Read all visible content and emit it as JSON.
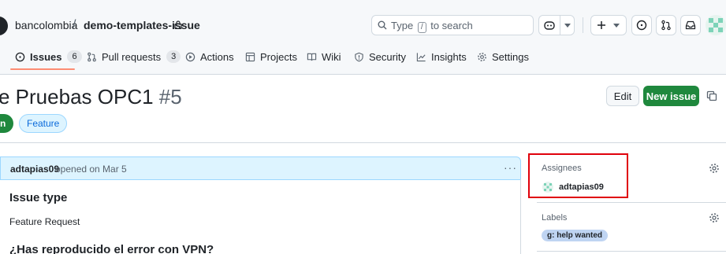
{
  "header": {
    "owner": "bancolombia",
    "separator": "/",
    "repo": "demo-templates-issue",
    "search": {
      "prefix": "Type",
      "key": "/",
      "suffix": "to search"
    }
  },
  "tabs": [
    {
      "label": "Issues",
      "count": "6"
    },
    {
      "label": "Pull requests",
      "count": "3"
    },
    {
      "label": "Actions"
    },
    {
      "label": "Projects"
    },
    {
      "label": "Wiki"
    },
    {
      "label": "Security"
    },
    {
      "label": "Insights"
    },
    {
      "label": "Settings"
    }
  ],
  "issue": {
    "title": "e Pruebas OPC1",
    "number": "#5",
    "status": "n",
    "labels": [
      "Feature"
    ],
    "edit_label": "Edit",
    "new_issue_label": "New issue"
  },
  "comment": {
    "author": "adtapias09",
    "meta": "opened on Mar 5",
    "heading1": "Issue type",
    "text1": "Feature Request",
    "heading2": "¿Has reproducido el error con VPN?"
  },
  "sidebar": {
    "assignees_title": "Assignees",
    "assignee": "adtapias09",
    "labels_title": "Labels",
    "label": "g: help wanted"
  },
  "colors": {
    "accent_green": "#1f883d",
    "highlight_red": "#e0000b",
    "tab_underline": "#fd8c73"
  }
}
